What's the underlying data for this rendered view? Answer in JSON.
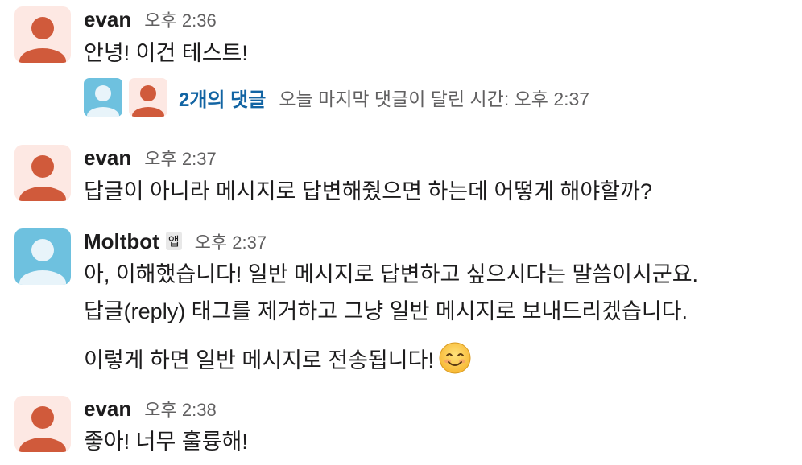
{
  "messages": [
    {
      "author": "evan",
      "time": "오후 2:36",
      "lines": [
        "안녕! 이건 테스트!"
      ],
      "avatar": "user-avatar-red",
      "thread": {
        "reply_count": "2개의 댓글",
        "last_reply": "오늘 마지막 댓글이 달린 시간: 오후 2:37"
      }
    },
    {
      "author": "evan",
      "time": "오후 2:37",
      "lines": [
        "답글이 아니라 메시지로 답변해줬으면 하는데 어떻게 해야할까?"
      ],
      "avatar": "user-avatar-red"
    },
    {
      "author": "Moltbot",
      "badge": "앱",
      "time": "오후 2:37",
      "lines": [
        "아, 이해했습니다! 일반 메시지로 답변하고 싶으시다는 말씀이시군요.",
        "답글(reply) 태그를 제거하고 그냥 일반 메시지로 보내드리겠습니다.",
        "이렇게 하면 일반 메시지로 전송됩니다!"
      ],
      "emoji": "smiling-face-emoji",
      "avatar": "bot-avatar-blue"
    },
    {
      "author": "evan",
      "time": "오후 2:38",
      "lines": [
        "좋아! 너무 훌륭해!"
      ],
      "avatar": "user-avatar-red"
    }
  ],
  "colors": {
    "user_avatar_bg": "#fde8e3",
    "user_avatar_fg": "#d05a3b",
    "bot_avatar_bg": "#6ec1df",
    "bot_avatar_fg": "#e8f4fa",
    "link": "#1264a3",
    "muted": "#616061"
  }
}
